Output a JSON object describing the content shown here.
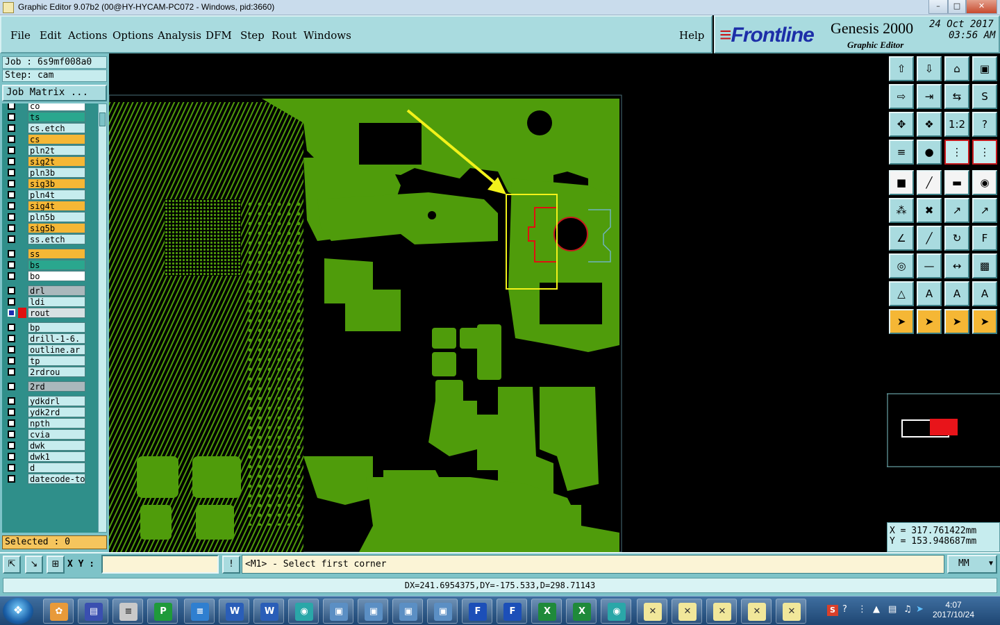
{
  "window": {
    "title": "Graphic Editor 9.07b2 (00@HY-HYCAM-PC072 - Windows, pid:3660)"
  },
  "menu": {
    "items": [
      "File",
      "Edit",
      "Actions",
      "Options",
      "Analysis",
      "DFM",
      "Step",
      "Rout",
      "Windows"
    ],
    "help": "Help"
  },
  "brand": {
    "logo": "Frontline",
    "product": "Genesis 2000",
    "subtitle": "Graphic Editor",
    "date": "24 Oct 2017",
    "time": "03:56 AM"
  },
  "job": {
    "job_label": "Job : 6s9mf008a0",
    "step_label": "Step: cam",
    "matrix_button": "Job Matrix ..."
  },
  "layers": [
    {
      "name": "co",
      "color": "#ffffff",
      "active": false,
      "flag": "⚑"
    },
    {
      "name": "ts",
      "color": "#2aa78e",
      "active": false,
      "flag": ""
    },
    {
      "name": "cs.etch",
      "color": "#c6ecee",
      "active": false,
      "flag": ""
    },
    {
      "name": "cs",
      "color": "#f5b735",
      "active": false,
      "flag": ""
    },
    {
      "name": "pln2t",
      "color": "#c6ecee",
      "active": false,
      "flag": ""
    },
    {
      "name": "sig2t",
      "color": "#f5b735",
      "active": false,
      "flag": ""
    },
    {
      "name": "pln3b",
      "color": "#c6ecee",
      "active": false,
      "flag": ""
    },
    {
      "name": "sig3b",
      "color": "#f5b735",
      "active": false,
      "flag": ""
    },
    {
      "name": "pln4t",
      "color": "#c6ecee",
      "active": false,
      "flag": ""
    },
    {
      "name": "sig4t",
      "color": "#f5b735",
      "active": false,
      "flag": ""
    },
    {
      "name": "pln5b",
      "color": "#c6ecee",
      "active": false,
      "flag": ""
    },
    {
      "name": "sig5b",
      "color": "#f5b735",
      "active": false,
      "flag": ""
    },
    {
      "name": "ss.etch",
      "color": "#c6ecee",
      "active": false,
      "flag": ""
    },
    {
      "name": "ss",
      "color": "#f5b735",
      "active": false,
      "flag": ""
    },
    {
      "name": "bs",
      "color": "#2aa78e",
      "active": false,
      "flag": ""
    },
    {
      "name": "bo",
      "color": "#ffffff",
      "active": false,
      "flag": "⚑"
    },
    {
      "name": "drl",
      "color": "#aab8bc",
      "active": false,
      "flag": ""
    },
    {
      "name": "ldi",
      "color": "#c6ecee",
      "active": false,
      "flag": ""
    },
    {
      "name": "rout",
      "color": "#d7e1e3",
      "active": true,
      "flag": "⊞"
    },
    {
      "name": "bp",
      "color": "#c6ecee",
      "active": false,
      "flag": ""
    },
    {
      "name": "drill-1-6.",
      "color": "#c6ecee",
      "active": false,
      "flag": "⚑"
    },
    {
      "name": "outline.ar",
      "color": "#c6ecee",
      "active": false,
      "flag": "⚑"
    },
    {
      "name": "tp",
      "color": "#c6ecee",
      "active": false,
      "flag": ""
    },
    {
      "name": "2rdrou",
      "color": "#c6ecee",
      "active": false,
      "flag": ""
    },
    {
      "name": "2rd",
      "color": "#aab8bc",
      "active": false,
      "flag": ""
    },
    {
      "name": "ydkdrl",
      "color": "#c6ecee",
      "active": false,
      "flag": ""
    },
    {
      "name": "ydk2rd",
      "color": "#c6ecee",
      "active": false,
      "flag": ""
    },
    {
      "name": "npth",
      "color": "#c6ecee",
      "active": false,
      "flag": ""
    },
    {
      "name": "cvia",
      "color": "#c6ecee",
      "active": false,
      "flag": ""
    },
    {
      "name": "dwk",
      "color": "#c6ecee",
      "active": false,
      "flag": ""
    },
    {
      "name": "dwk1",
      "color": "#c6ecee",
      "active": false,
      "flag": ""
    },
    {
      "name": "d",
      "color": "#c6ecee",
      "active": false,
      "flag": ""
    },
    {
      "name": "datecode-to",
      "color": "#c6ecee",
      "active": false,
      "flag": ""
    }
  ],
  "selected": "Selected : 0",
  "coords": {
    "x": "X = 317.761422mm",
    "y": "Y = 153.948687mm"
  },
  "command": {
    "xy_label": "X Y :",
    "xy_value": "",
    "prompt": "<M1> - Select first corner",
    "units": "MM"
  },
  "status": "DX=241.6954375,DY=-175.533,D=298.71143",
  "taskbar": {
    "clock_time": "4:07",
    "clock_date": "2017/10/24"
  },
  "colors": {
    "copper": "#4f9c0b",
    "highlight_box": "#f2f21a",
    "rout": "#e01010",
    "panel": "#a9dbdf"
  }
}
